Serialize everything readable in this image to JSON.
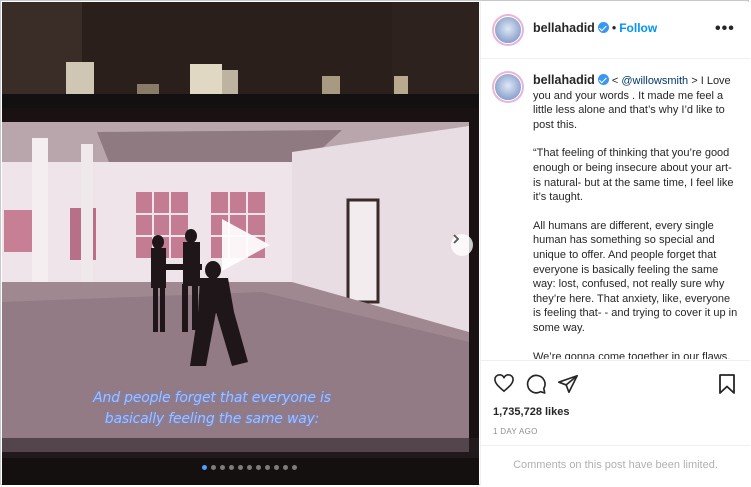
{
  "post": {
    "username": "bellahadid",
    "follow_label": "Follow",
    "separator": "•",
    "more_label": "•••",
    "caption": {
      "line1_prefix": "< ",
      "mention": "@willowsmith",
      "line1_suffix": " > I Love you and your words . It made me feel a little less alone and that’s why I’d like to post this.",
      "paragraph2": "“That feeling of thinking that you’re good enough or being insecure about your art- is natural- but at the same time, I feel like it’s taught.",
      "paragraph3": "All humans are different, every single human has something so special and unique to offer. And people forget that everyone is basically feeling the same way: lost, confused, not really sure why they’re here. That anxiety, like, everyone is feeling that- - and trying to cover it up in some way.",
      "paragraph4": "We’re gonna come together in our flaws."
    },
    "likes": "1,735,728 likes",
    "time_ago": "1 DAY AGO",
    "comments_limited": "Comments on this post have been limited."
  },
  "media": {
    "subtitle_line1": "And people forget that everyone is",
    "subtitle_line2": "basically feeling the same way:",
    "carousel_count": 11,
    "carousel_active_index": 0
  },
  "icons": {
    "like": "heart-icon",
    "comment": "comment-icon",
    "share": "share-icon",
    "save": "bookmark-icon",
    "play": "play-icon",
    "next": "chevron-right-icon",
    "verified": "verified-badge-icon"
  },
  "colors": {
    "link": "#0095f6",
    "verified": "#3897f0",
    "subtitle": "#9fc0ff",
    "active_dot": "#4aa0ff"
  }
}
